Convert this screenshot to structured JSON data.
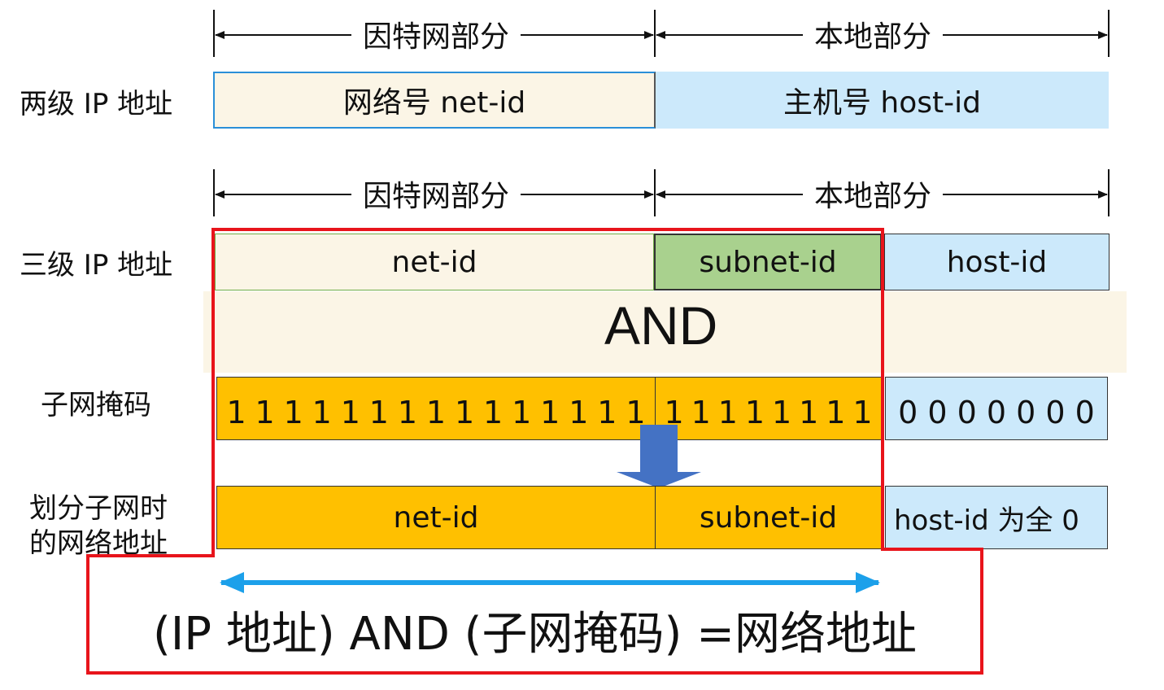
{
  "top": {
    "internet_part": "因特网部分",
    "local_part": "本地部分"
  },
  "two_level": {
    "label": "两级 IP 地址",
    "net": "网络号 net-id",
    "host": "主机号 host-id"
  },
  "mid": {
    "internet_part": "因特网部分",
    "local_part": "本地部分"
  },
  "three_level": {
    "label": "三级 IP 地址",
    "net": "net-id",
    "subnet": "subnet-id",
    "host": "host-id"
  },
  "and_text": "AND",
  "mask": {
    "label": "子网掩码",
    "net_bits": [
      "1",
      "1",
      "1",
      "1",
      "1",
      "1",
      "1",
      "1",
      "1",
      "1",
      "1",
      "1",
      "1",
      "1",
      "1"
    ],
    "subnet_bits": [
      "1",
      "1",
      "1",
      "1",
      "1",
      "1",
      "1",
      "1"
    ],
    "host_bits": "0 0 0 0 0 0 0"
  },
  "network_address": {
    "label_line1": "划分子网时",
    "label_line2": "的网络地址",
    "net": "net-id",
    "subnet": "subnet-id",
    "host": "host-id 为全 0"
  },
  "formula": "(IP 地址) AND (子网掩码) =网络地址",
  "colors": {
    "cream": "#fbf5e6",
    "light_blue": "#cce9fb",
    "green": "#a9d18e",
    "orange": "#ffc000",
    "red": "#e8141b",
    "arrow_blue": "#4472c4",
    "cyan_arrow": "#1ca0ea"
  }
}
